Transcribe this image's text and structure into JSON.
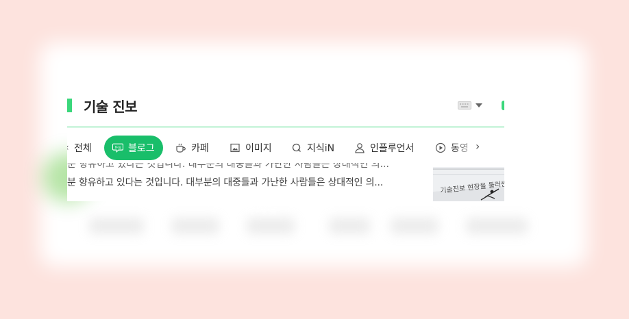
{
  "section": {
    "title": "기술 진보"
  },
  "tabs": [
    {
      "label": "전체",
      "icon": "chevron-left-icon"
    },
    {
      "label": "블로그",
      "icon": "blog-icon",
      "active": true
    },
    {
      "label": "카페",
      "icon": "cafe-cup-icon"
    },
    {
      "label": "이미지",
      "icon": "image-icon"
    },
    {
      "label": "지식iN",
      "icon": "knowledge-q-icon"
    },
    {
      "label": "인플루언서",
      "icon": "influencer-person-icon"
    },
    {
      "label": "동영",
      "icon": "video-play-icon"
    }
  ],
  "snippet": {
    "text": "분 향유하고 있다는 것입니다. 대부분의 대중들과 가난한 사람들은 상대적인 의..."
  },
  "thumbnail": {
    "caption": "기술진보 현장을 둘러싼 문"
  },
  "background": {
    "faded_text": "빠져유"
  },
  "colors": {
    "accent": "#3ad77b",
    "tab_active": "#19be6a"
  }
}
